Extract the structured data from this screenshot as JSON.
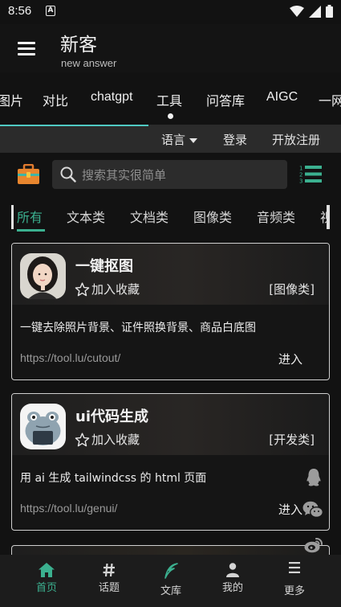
{
  "status_bar": {
    "time": "8:56",
    "notif_icon_letter": "A"
  },
  "app_bar": {
    "title": "新客",
    "subtitle": "new answer"
  },
  "category_tabs": [
    {
      "label": "图片"
    },
    {
      "label": "对比"
    },
    {
      "label": "chatgpt"
    },
    {
      "label": "工具",
      "active": true
    },
    {
      "label": "问答库"
    },
    {
      "label": "AIGC"
    },
    {
      "label": "一网"
    }
  ],
  "util_bar": {
    "language_label": "语言",
    "login_label": "登录",
    "register_label": "开放注册"
  },
  "search": {
    "placeholder": "搜索其实很简单"
  },
  "filter_tabs": [
    {
      "label": "所有",
      "active": true
    },
    {
      "label": "文本类"
    },
    {
      "label": "文档类"
    },
    {
      "label": "图像类"
    },
    {
      "label": "音频类"
    },
    {
      "label": "视"
    }
  ],
  "cards": [
    {
      "title": "一键抠图",
      "favorite_label": "加入收藏",
      "category": "[图像类]",
      "description": "一键去除照片背景、证件照换背景、商品白底图",
      "url": "https://tool.lu/cutout/",
      "enter_label": "进入",
      "avatar_icon": "portrait-avatar"
    },
    {
      "title": "ui代码生成",
      "favorite_label": "加入收藏",
      "category": "[开发类]",
      "description": "用 ai 生成 tailwindcss 的 html 页面",
      "url": "https://tool.lu/genui/",
      "enter_label": "进入",
      "avatar_icon": "frog-avatar"
    }
  ],
  "side_share_icons": [
    "qq-icon",
    "wechat-icon",
    "weibo-icon"
  ],
  "bottom_nav": [
    {
      "label": "首页",
      "icon": "home-icon",
      "active": true
    },
    {
      "label": "话题",
      "icon": "hashtag-icon"
    },
    {
      "label": "文库",
      "icon": "quill-icon"
    },
    {
      "label": "我的",
      "icon": "person-icon"
    },
    {
      "label": "更多",
      "icon": "menu-icon"
    }
  ],
  "colors": {
    "accent": "#3bb08f",
    "tab_indicator": "#4fc9c2",
    "background": "#121212"
  }
}
